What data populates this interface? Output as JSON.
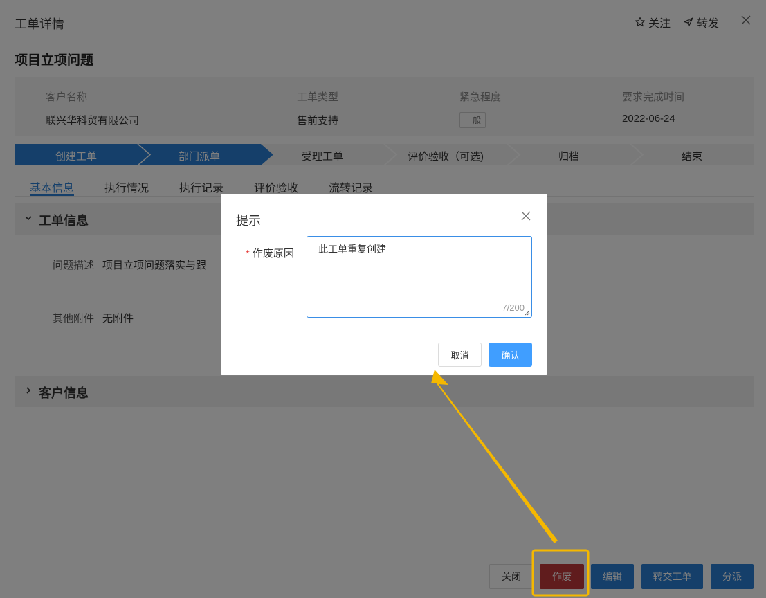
{
  "header": {
    "title": "工单详情",
    "follow_label": "关注",
    "forward_label": "转发"
  },
  "ticket": {
    "title": "项目立项问题",
    "info": [
      {
        "label": "客户名称",
        "value": "联兴华科贸有限公司"
      },
      {
        "label": "工单类型",
        "value": "售前支持"
      },
      {
        "label": "紧急程度",
        "value": "一般"
      },
      {
        "label": "要求完成时间",
        "value": "2022-06-24"
      }
    ]
  },
  "steps": [
    {
      "label": "创建工单",
      "state": "done"
    },
    {
      "label": "部门派单",
      "state": "done"
    },
    {
      "label": "受理工单",
      "state": "todo"
    },
    {
      "label": "评价验收（可选)",
      "state": "todo"
    },
    {
      "label": "归档",
      "state": "todo"
    },
    {
      "label": "结束",
      "state": "todo"
    }
  ],
  "tabs": [
    {
      "label": "基本信息",
      "active": true
    },
    {
      "label": "执行情况"
    },
    {
      "label": "执行记录"
    },
    {
      "label": "评价验收"
    },
    {
      "label": "流转记录"
    }
  ],
  "sections": {
    "ticket_info": {
      "title": "工单信息",
      "desc_label": "问题描述",
      "desc_value": "项目立项问题落实与跟",
      "attach_label": "其他附件",
      "attach_value": "无附件"
    },
    "customer_info": {
      "title": "客户信息"
    }
  },
  "footer": {
    "close": "关闭",
    "void": "作废",
    "edit": "编辑",
    "transfer": "转交工单",
    "dispatch": "分派"
  },
  "modal": {
    "title": "提示",
    "required_mark": "*",
    "field_label": "作废原因",
    "textarea_value": "此工单重复创建",
    "char_count": "7/200",
    "cancel": "取消",
    "confirm": "确认"
  },
  "colors": {
    "primary": "#2a7fd4",
    "danger": "#c0393b",
    "annotation": "#f5b800"
  }
}
